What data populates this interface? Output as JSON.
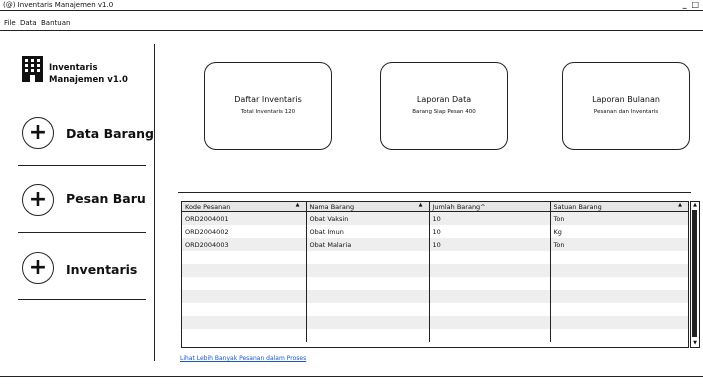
{
  "window": {
    "title": "(@) Inventaris Manajemen v1.0",
    "controls": "_ □"
  },
  "menu": [
    "File",
    "Data",
    "Bantuan"
  ],
  "sidebar": {
    "app_name_line1": "Inventaris",
    "app_name_line2": "Manajemen v1.0",
    "nav": [
      {
        "label": "Data Barang",
        "icon": "plus-icon"
      },
      {
        "label": "Pesan Baru",
        "icon": "plus-icon"
      },
      {
        "label": "Inventaris",
        "icon": "plus-icon"
      }
    ]
  },
  "cards": [
    {
      "title": "Daftar Inventaris",
      "subtitle": "Total Inventaris 120"
    },
    {
      "title": "Laporan Data",
      "subtitle": "Barang Siap Pesan 400"
    },
    {
      "title": "Laporan Bulanan",
      "subtitle": "Pesanan dan Inventaris"
    }
  ],
  "table": {
    "columns": [
      "Kode Pesanan",
      "Nama Barang",
      "Jumlah Barang^",
      "Satuan Barang"
    ],
    "rows": [
      [
        "ORD2004001",
        "Obat Vaksin",
        "10",
        "Ton"
      ],
      [
        "ORD2004002",
        "Obat Imun",
        "10",
        "Kg"
      ],
      [
        "ORD2004003",
        "Obat Malaria",
        "10",
        "Ton"
      ]
    ]
  },
  "link_text": "Lihat Lebih Banyak Pesanan dalam Proses"
}
